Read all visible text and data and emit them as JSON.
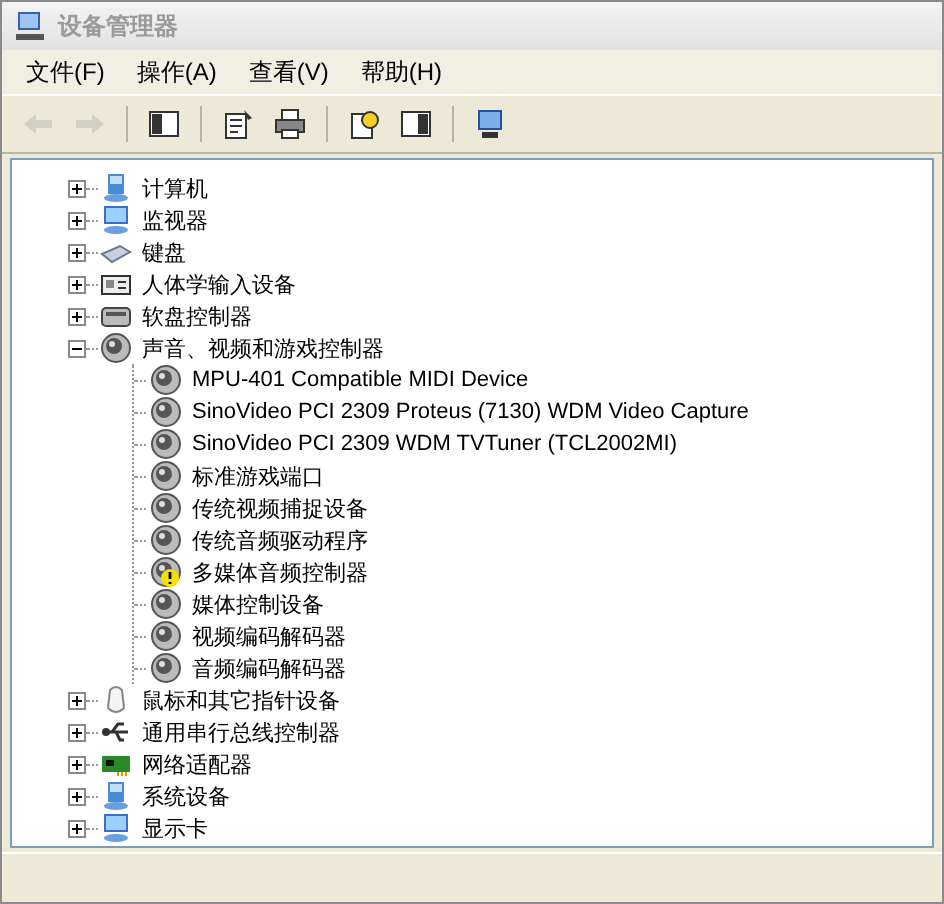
{
  "window": {
    "title": "设备管理器"
  },
  "menu": [
    "文件(F)",
    "操作(A)",
    "查看(V)",
    "帮助(H)"
  ],
  "toolbar": [
    {
      "kind": "back",
      "disabled": true
    },
    {
      "kind": "forward",
      "disabled": true
    },
    {
      "kind": "sep"
    },
    {
      "kind": "tree",
      "disabled": false
    },
    {
      "kind": "sep"
    },
    {
      "kind": "properties",
      "disabled": false
    },
    {
      "kind": "print",
      "disabled": false
    },
    {
      "kind": "sep"
    },
    {
      "kind": "help",
      "disabled": false
    },
    {
      "kind": "panel",
      "disabled": false
    },
    {
      "kind": "sep"
    },
    {
      "kind": "scan",
      "disabled": false
    }
  ],
  "tree": [
    {
      "label": "计算机",
      "kind": "computer",
      "expanded": false
    },
    {
      "label": "监视器",
      "kind": "monitor",
      "expanded": false
    },
    {
      "label": "键盘",
      "kind": "keyboard",
      "expanded": false
    },
    {
      "label": "人体学输入设备",
      "kind": "hid",
      "expanded": false
    },
    {
      "label": "软盘控制器",
      "kind": "floppy",
      "expanded": false
    },
    {
      "label": "声音、视频和游戏控制器",
      "kind": "sound",
      "expanded": true,
      "children": [
        {
          "label": "MPU-401 Compatible MIDI Device",
          "kind": "sound",
          "warning": false
        },
        {
          "label": "SinoVideo PCI 2309 Proteus (7130) WDM Video Capture",
          "kind": "sound",
          "warning": false
        },
        {
          "label": "SinoVideo PCI 2309 WDM TVTuner (TCL2002MI)",
          "kind": "sound",
          "warning": false
        },
        {
          "label": "标准游戏端口",
          "kind": "sound",
          "warning": false
        },
        {
          "label": "传统视频捕捉设备",
          "kind": "sound",
          "warning": false
        },
        {
          "label": "传统音频驱动程序",
          "kind": "sound",
          "warning": false
        },
        {
          "label": "多媒体音频控制器",
          "kind": "sound",
          "warning": true
        },
        {
          "label": "媒体控制设备",
          "kind": "sound",
          "warning": false
        },
        {
          "label": "视频编码解码器",
          "kind": "sound",
          "warning": false
        },
        {
          "label": "音频编码解码器",
          "kind": "sound",
          "warning": false
        }
      ]
    },
    {
      "label": "鼠标和其它指针设备",
      "kind": "mouse",
      "expanded": false
    },
    {
      "label": "通用串行总线控制器",
      "kind": "usb",
      "expanded": false
    },
    {
      "label": "网络适配器",
      "kind": "network",
      "expanded": false
    },
    {
      "label": "系统设备",
      "kind": "computer",
      "expanded": false
    },
    {
      "label": "显示卡",
      "kind": "monitor",
      "expanded": false
    }
  ]
}
